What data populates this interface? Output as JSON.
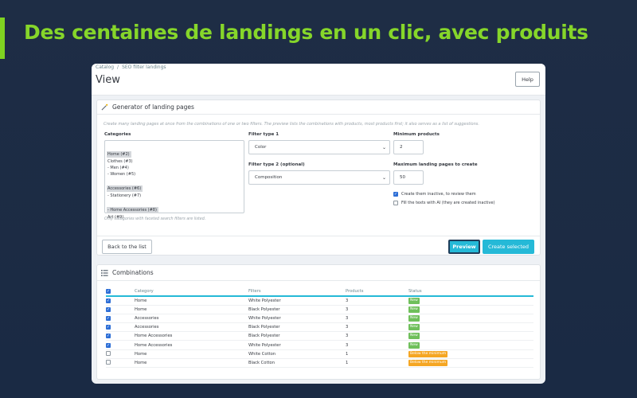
{
  "headline": "Des centaines de landings en un clic, avec produits",
  "breadcrumb": [
    "Catalog",
    "SEO filter landings"
  ],
  "page_title": "View",
  "help_label": "Help",
  "generator": {
    "title": "Generator of landing pages",
    "description": "Create many landing pages at once from the combinations of one or two filters. The preview lists the combinations with products, most products first; it also serves as a list of suggestions.",
    "categories_label": "Categories",
    "categories": [
      {
        "label": "Home (#2)",
        "selected": true
      },
      {
        "label": "Clothes (#3)",
        "selected": false
      },
      {
        "label": "- Men (#4)",
        "selected": false
      },
      {
        "label": "- Women (#5)",
        "selected": false
      },
      {
        "label": "Accessories (#6)",
        "selected": true
      },
      {
        "label": "- Stationery (#7)",
        "selected": false
      },
      {
        "label": "- Home Accessories (#8)",
        "selected": true
      },
      {
        "label": "Art (#9)",
        "selected": false
      }
    ],
    "categories_hint": "Only categories with faceted search filters are listed.",
    "filter1_label": "Filter type 1",
    "filter1_value": "Color",
    "filter2_label": "Filter type 2 (optional)",
    "filter2_value": "Composition",
    "min_products_label": "Minimum products",
    "min_products_value": "2",
    "max_pages_label": "Maximum landing pages to create",
    "max_pages_value": "50",
    "inactive_label": "Create them inactive, to review them",
    "inactive_checked": true,
    "ai_label": "Fill the texts with AI (they are created inactive)",
    "ai_checked": false,
    "back_label": "Back to the list",
    "preview_label": "Preview",
    "create_label": "Create selected"
  },
  "combinations": {
    "title": "Combinations",
    "columns": [
      "Category",
      "Filters",
      "Products",
      "Status"
    ],
    "header_checked": true,
    "rows": [
      {
        "checked": true,
        "category": "Home",
        "filters": "White Polyester",
        "products": "3",
        "status": "New",
        "status_type": "new"
      },
      {
        "checked": true,
        "category": "Home",
        "filters": "Black Polyester",
        "products": "3",
        "status": "New",
        "status_type": "new"
      },
      {
        "checked": true,
        "category": "Accessories",
        "filters": "White Polyester",
        "products": "3",
        "status": "New",
        "status_type": "new"
      },
      {
        "checked": true,
        "category": "Accessories",
        "filters": "Black Polyester",
        "products": "3",
        "status": "New",
        "status_type": "new"
      },
      {
        "checked": true,
        "category": "Home Accessories",
        "filters": "Black Polyester",
        "products": "3",
        "status": "New",
        "status_type": "new"
      },
      {
        "checked": true,
        "category": "Home Accessories",
        "filters": "White Polyester",
        "products": "3",
        "status": "New",
        "status_type": "new"
      },
      {
        "checked": false,
        "category": "Home",
        "filters": "White Cotton",
        "products": "1",
        "status": "Below the minimum",
        "status_type": "below"
      },
      {
        "checked": false,
        "category": "Home",
        "filters": "Black Cotton",
        "products": "1",
        "status": "Below the minimum",
        "status_type": "below"
      }
    ]
  },
  "colors": {
    "accent": "#86d62a",
    "primary": "#25b9d7",
    "new": "#6fbf5b",
    "below": "#f5a623"
  }
}
